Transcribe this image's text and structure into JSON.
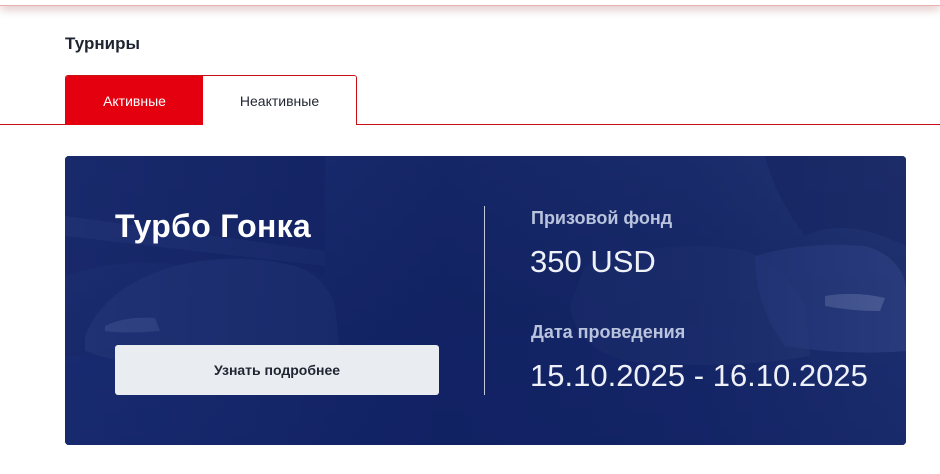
{
  "page": {
    "title": "Турниры"
  },
  "tabs": [
    {
      "label": "Активные",
      "active": true
    },
    {
      "label": "Неактивные",
      "active": false
    }
  ],
  "tournament": {
    "name": "Турбо Гонка",
    "details_button": "Узнать подробнее",
    "prize_label": "Призовой фонд",
    "prize_value": "350 USD",
    "date_label": "Дата проведения",
    "date_value": "15.10.2025 - 16.10.2025",
    "background_image": "race-cars-on-track"
  },
  "colors": {
    "accent": "#e4000f",
    "card_bg": "#0c1c5e",
    "button_bg": "#e9edf2",
    "text_dark": "#1f2530"
  }
}
